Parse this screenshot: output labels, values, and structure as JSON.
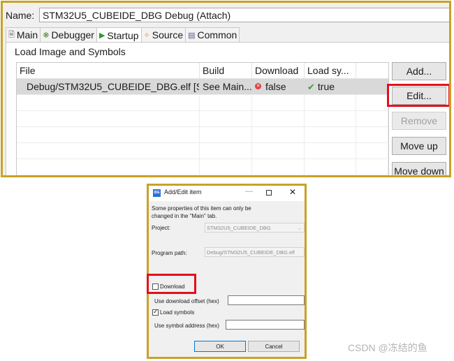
{
  "top": {
    "name_label": "Name:",
    "name_value": "STM32U5_CUBEIDE_DBG Debug (Attach)",
    "tabs": [
      {
        "label": "Main",
        "icon": "document-icon"
      },
      {
        "label": "Debugger",
        "icon": "bug-icon"
      },
      {
        "label": "Startup",
        "icon": "play-icon"
      },
      {
        "label": "Source",
        "icon": "source-icon"
      },
      {
        "label": "Common",
        "icon": "common-icon"
      }
    ],
    "active_tab": "Startup",
    "group_title": "Load Image and Symbols",
    "table": {
      "headers": [
        "File",
        "Build",
        "Download",
        "Load sy..."
      ],
      "rows": [
        {
          "file": "Debug/STM32U5_CUBEIDE_DBG.elf [ST...",
          "build": "See Main...",
          "download": "false",
          "load_symbols": "true"
        }
      ]
    },
    "buttons": {
      "add": "Add...",
      "edit": "Edit...",
      "remove": "Remove",
      "move_up": "Move up",
      "move_down": "Move down"
    }
  },
  "dialog": {
    "title": "Add/Edit item",
    "badge": "IDE",
    "win_min": "—",
    "win_close": "✕",
    "note": "Some properties of this item can only be changed in the \"Main\" tab.",
    "project_label": "Project:",
    "project_value": "STM32U5_CUBEIDE_DBG",
    "program_path_label": "Program path:",
    "program_path_value": "Debug/STM32U5_CUBEIDE_DBG.elf",
    "download_label": "Download",
    "download_checked": false,
    "offset_label": "Use download offset (hex)",
    "load_symbols_label": "Load symbols",
    "load_symbols_checked": true,
    "symbol_address_label": "Use symbol address (hex)",
    "ok_label": "OK",
    "cancel_label": "Cancel"
  },
  "watermark": "CSDN @冻结的鱼",
  "colors": {
    "frame_border": "#c9a227",
    "highlight_border": "#e3101c",
    "selected_row": "#d9d9d9"
  }
}
